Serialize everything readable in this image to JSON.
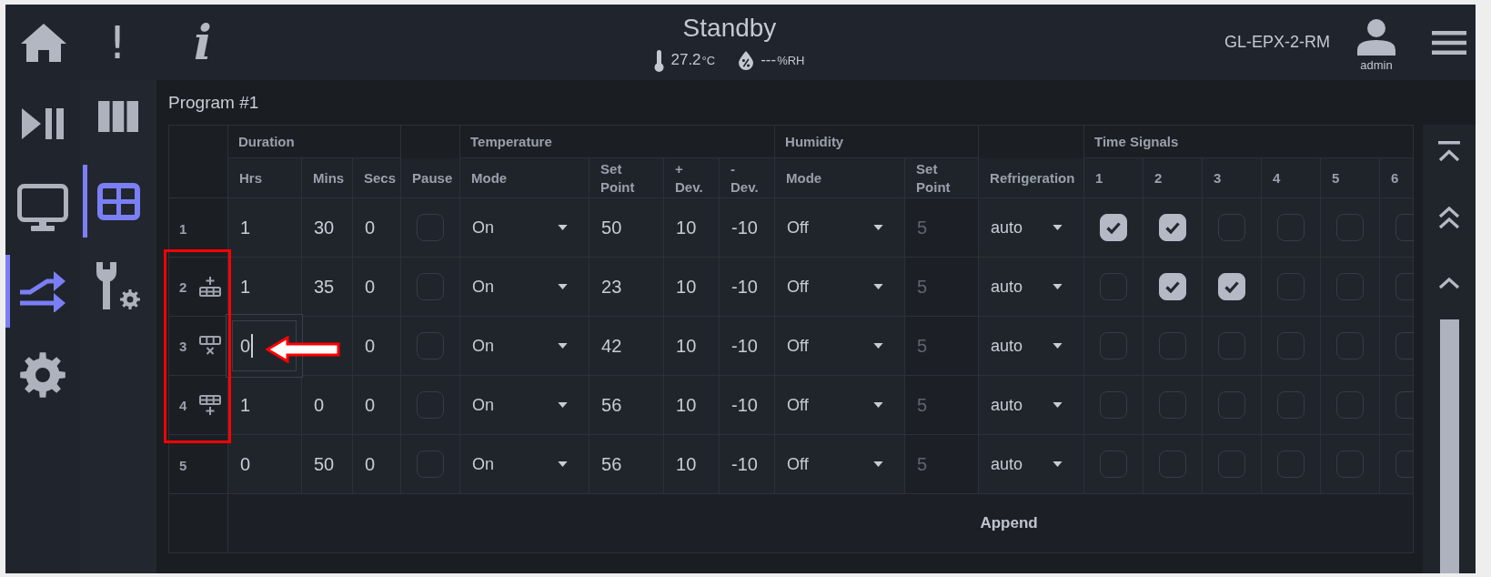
{
  "top_bar": {
    "alert_button": "!",
    "info_button": "i",
    "status": "Standby",
    "temperature": "27.2",
    "temperature_unit": "°C",
    "humidity": "---",
    "humidity_unit": "%RH",
    "device_name": "GL-EPX-2-RM",
    "user": "admin"
  },
  "nav": [
    {
      "selected": false
    },
    {
      "selected": false
    },
    {
      "selected": true
    },
    {
      "selected": false
    }
  ],
  "sub_nav": [
    {
      "selected": false
    },
    {
      "selected": true
    },
    {
      "selected": false
    }
  ],
  "program": {
    "title": "Program #1",
    "columns": [
      {
        "group": "Duration",
        "columns": [
          "Hrs",
          "Mins",
          "Secs"
        ]
      },
      {
        "columns": [
          "Pause"
        ]
      },
      {
        "group": "Temperature",
        "columns": [
          "Mode",
          "Set Point",
          "+ Dev.",
          "- Dev."
        ]
      },
      {
        "group": "Humidity",
        "columns": [
          "Mode",
          "Set Point"
        ]
      },
      {
        "columns": [
          "Refrigeration"
        ]
      },
      {
        "group": "Time Signals",
        "columns": [
          "1",
          "2",
          "3",
          "4",
          "5",
          "6"
        ]
      }
    ],
    "rows": [
      {
        "index": "1",
        "kind": "plain",
        "hrs": "1",
        "hrs_focused": false,
        "mins": "30",
        "secs": "0",
        "pause": false,
        "temp_mode": "On",
        "temp_set_point": "50",
        "plus_dev": "10",
        "minus_dev": "-10",
        "hum_mode": "Off",
        "hum_set_point": "5",
        "hum_set_point_disabled": true,
        "refrigeration": "auto",
        "time_signals": [
          {
            "checked": true
          },
          {
            "checked": true
          },
          {
            "checked": false
          },
          {
            "checked": false
          },
          {
            "checked": false
          },
          {
            "checked": false
          }
        ]
      },
      {
        "index": "2",
        "kind": "above",
        "hrs": "1",
        "hrs_focused": false,
        "mins": "35",
        "secs": "0",
        "pause": false,
        "temp_mode": "On",
        "temp_set_point": "23",
        "plus_dev": "10",
        "minus_dev": "-10",
        "hum_mode": "Off",
        "hum_set_point": "5",
        "hum_set_point_disabled": true,
        "refrigeration": "auto",
        "time_signals": [
          {
            "checked": false
          },
          {
            "checked": true
          },
          {
            "checked": true
          },
          {
            "checked": false
          },
          {
            "checked": false
          },
          {
            "checked": false
          }
        ]
      },
      {
        "index": "3",
        "kind": "delete",
        "hrs": "0",
        "hrs_focused": true,
        "secs": "0",
        "pause": false,
        "temp_mode": "On",
        "temp_set_point": "42",
        "plus_dev": "10",
        "minus_dev": "-10",
        "hum_mode": "Off",
        "hum_set_point": "5",
        "hum_set_point_disabled": true,
        "refrigeration": "auto",
        "time_signals": [
          {
            "checked": false
          },
          {
            "checked": false
          },
          {
            "checked": false
          },
          {
            "checked": false
          },
          {
            "checked": false
          },
          {
            "checked": false
          }
        ]
      },
      {
        "index": "4",
        "kind": "below",
        "hrs": "1",
        "hrs_focused": false,
        "mins": "0",
        "secs": "0",
        "pause": false,
        "temp_mode": "On",
        "temp_set_point": "56",
        "plus_dev": "10",
        "minus_dev": "-10",
        "hum_mode": "Off",
        "hum_set_point": "5",
        "hum_set_point_disabled": true,
        "refrigeration": "auto",
        "time_signals": [
          {
            "checked": false
          },
          {
            "checked": false
          },
          {
            "checked": false
          },
          {
            "checked": false
          },
          {
            "checked": false
          },
          {
            "checked": false
          }
        ]
      },
      {
        "index": "5",
        "kind": "plain",
        "hrs": "0",
        "hrs_focused": false,
        "mins": "50",
        "secs": "0",
        "pause": false,
        "temp_mode": "On",
        "temp_set_point": "56",
        "plus_dev": "10",
        "minus_dev": "-10",
        "hum_mode": "Off",
        "hum_set_point": "5",
        "hum_set_point_disabled": true,
        "refrigeration": "auto",
        "time_signals": [
          {
            "checked": false
          },
          {
            "checked": false
          },
          {
            "checked": false
          },
          {
            "checked": false
          },
          {
            "checked": false
          },
          {
            "checked": false
          }
        ]
      }
    ],
    "append_button": "Append"
  }
}
